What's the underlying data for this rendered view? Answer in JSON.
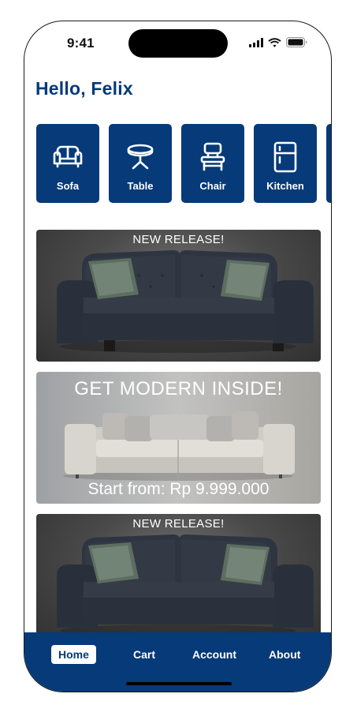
{
  "status_bar": {
    "time": "9:41",
    "icons": [
      "cellular-signal-icon",
      "wifi-icon",
      "battery-icon"
    ]
  },
  "greeting": "Hello, Felix",
  "categories": [
    {
      "label": "Sofa",
      "icon": "sofa-icon"
    },
    {
      "label": "Table",
      "icon": "table-icon"
    },
    {
      "label": "Chair",
      "icon": "chair-icon"
    },
    {
      "label": "Kitchen",
      "icon": "fridge-icon"
    }
  ],
  "banners": [
    {
      "tag": "NEW RELEASE!",
      "image": "dark-sofa"
    },
    {
      "headline": "GET MODERN INSIDE!",
      "price": "Start from: Rp 9.999.000",
      "image": "grey-sectional-sofa"
    },
    {
      "tag": "NEW RELEASE!",
      "image": "dark-sofa"
    }
  ],
  "bottom_nav": {
    "items": [
      {
        "label": "Home",
        "active": true
      },
      {
        "label": "Cart",
        "active": false
      },
      {
        "label": "Account",
        "active": false
      },
      {
        "label": "About",
        "active": false
      }
    ]
  },
  "colors": {
    "brand": "#063a79",
    "background": "#ffffff"
  }
}
